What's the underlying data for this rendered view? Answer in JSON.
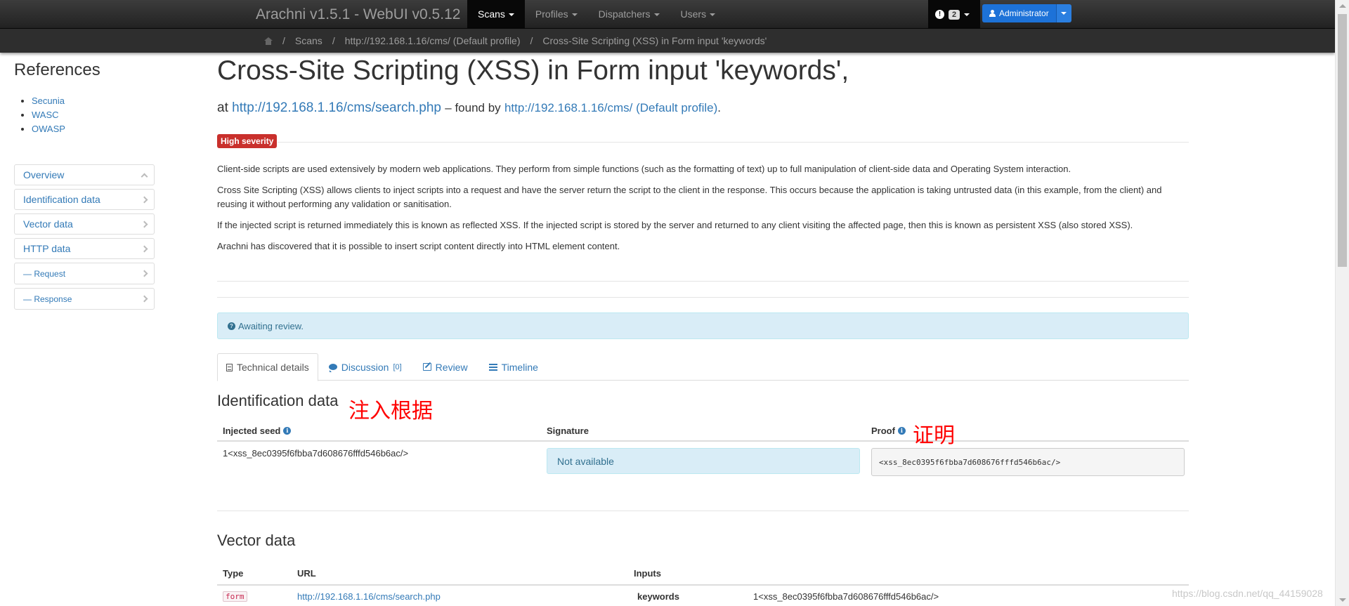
{
  "navbar": {
    "brand": "Arachni v1.5.1 - WebUI v0.5.12",
    "items": [
      {
        "label": "Scans",
        "active": true
      },
      {
        "label": "Profiles",
        "active": false
      },
      {
        "label": "Dispatchers",
        "active": false
      },
      {
        "label": "Users",
        "active": false
      }
    ],
    "notification_count": "2",
    "user": "Administrator"
  },
  "breadcrumb": {
    "items": [
      "Scans",
      "http://192.168.1.16/cms/ (Default profile)",
      "Cross-Site Scripting (XSS) in Form input 'keywords'"
    ]
  },
  "sidebar": {
    "references_title": "References",
    "references": [
      "Secunia",
      "WASC",
      "OWASP"
    ],
    "nav": [
      "Overview",
      "Identification data",
      "Vector data",
      "HTTP data",
      "— Request",
      "— Response"
    ]
  },
  "issue": {
    "title": "Cross-Site Scripting (XSS) in Form input 'keywords',",
    "at_label": "at",
    "url": "http://192.168.1.16/cms/search.php",
    "found_by_label": "– found by",
    "scan": "http://192.168.1.16/cms/ (Default profile)",
    "period": ".",
    "severity": "High severity",
    "description": [
      "Client-side scripts are used extensively by modern web applications. They perform from simple functions (such as the formatting of text) up to full manipulation of client-side data and Operating System interaction.",
      "Cross Site Scripting (XSS) allows clients to inject scripts into a request and have the server return the script to the client in the response. This occurs because the application is taking untrusted data (in this example, from the client) and reusing it without performing any validation or sanitisation.",
      "If the injected script is returned immediately this is known as reflected XSS. If the injected script is stored by the server and returned to any client visiting the affected page, then this is known as persistent XSS (also stored XSS).",
      "Arachni has discovered that it is possible to insert script content directly into HTML element content."
    ],
    "review_status": "Awaiting review."
  },
  "tabs": {
    "technical": "Technical details",
    "discussion": "Discussion",
    "discussion_count": "[0]",
    "review": "Review",
    "timeline": "Timeline"
  },
  "identification": {
    "title": "Identification data",
    "col_seed": "Injected seed",
    "col_signature": "Signature",
    "col_proof": "Proof",
    "seed": "1<xss_8ec0395f6fbba7d608676fffd546b6ac/>",
    "signature": "Not available",
    "proof": "<xss_8ec0395f6fbba7d608676fffd546b6ac/>"
  },
  "annotations": {
    "seed_note": "注入根据",
    "proof_note": "证明"
  },
  "vector": {
    "title": "Vector data",
    "col_type": "Type",
    "col_url": "URL",
    "col_inputs": "Inputs",
    "type": "form",
    "url": "http://192.168.1.16/cms/search.php",
    "input_name": "keywords",
    "input_value": "1<xss_8ec0395f6fbba7d608676fffd546b6ac/>"
  },
  "watermark": "https://blog.csdn.net/qq_44159028"
}
